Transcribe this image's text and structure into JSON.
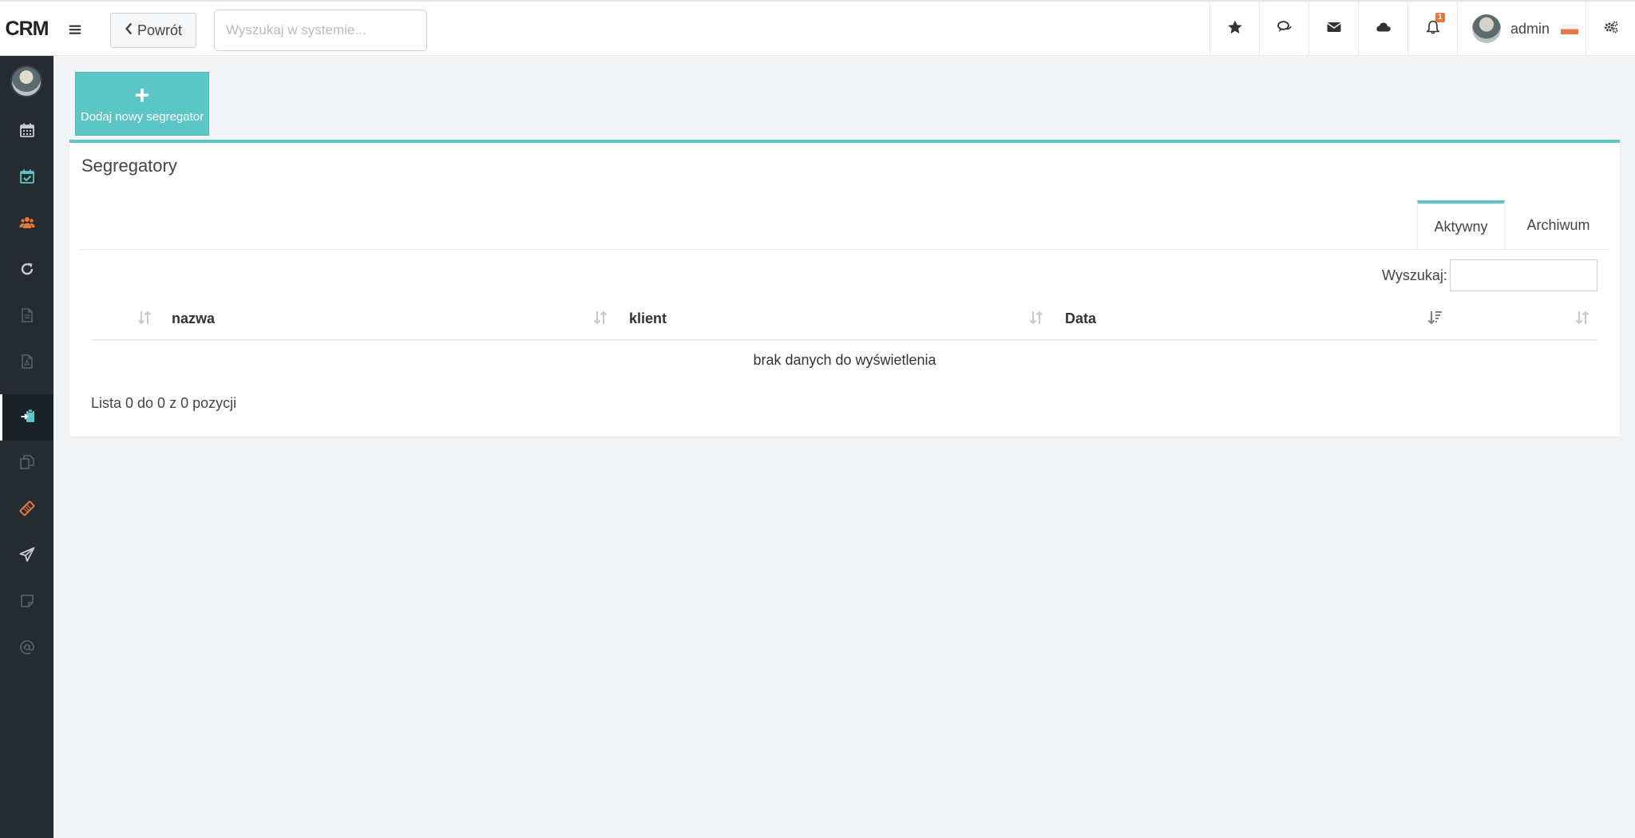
{
  "app": {
    "brand": "CRM"
  },
  "header": {
    "back_label": "Powrót",
    "search_placeholder": "Wyszukaj w systemie...",
    "notifications_count": "1",
    "user_name": "admin"
  },
  "sidebar": {
    "items": [
      {
        "icon": "calendar-icon",
        "color": "#c8ccd0"
      },
      {
        "icon": "calendar-check-icon",
        "color": "#5cc6c6"
      },
      {
        "icon": "users-icon",
        "color": "#e5773b"
      },
      {
        "icon": "refresh-icon",
        "color": "#c8ccd0"
      },
      {
        "icon": "document-icon",
        "color": "#5a6168"
      },
      {
        "icon": "pdf-icon",
        "color": "#5a6168"
      },
      {
        "icon": "clipboard-import-icon",
        "color": "#5cc6c6"
      },
      {
        "icon": "copy-icon",
        "color": "#5a6168"
      },
      {
        "icon": "ticket-icon",
        "color": "#e5773b"
      },
      {
        "icon": "paper-plane-icon",
        "color": "#c8ccd0"
      },
      {
        "icon": "note-icon",
        "color": "#5a6168"
      },
      {
        "icon": "at-icon",
        "color": "#5a6168"
      }
    ]
  },
  "toolbar": {
    "add_label": "Dodaj nowy segregator"
  },
  "panel": {
    "title": "Segregatory",
    "tabs": [
      {
        "label": "Aktywny",
        "active": true
      },
      {
        "label": "Archiwum",
        "active": false
      }
    ],
    "search_label": "Wyszukaj:",
    "search_value": "",
    "columns": [
      "nazwa",
      "klient",
      "Data"
    ],
    "empty_text": "brak danych do wyświetlenia",
    "info_text": "Lista 0 do 0 z 0 pozycji"
  },
  "colors": {
    "accent": "#5cc6c6",
    "sidebar_bg": "#252b31",
    "orange": "#e5773b"
  }
}
